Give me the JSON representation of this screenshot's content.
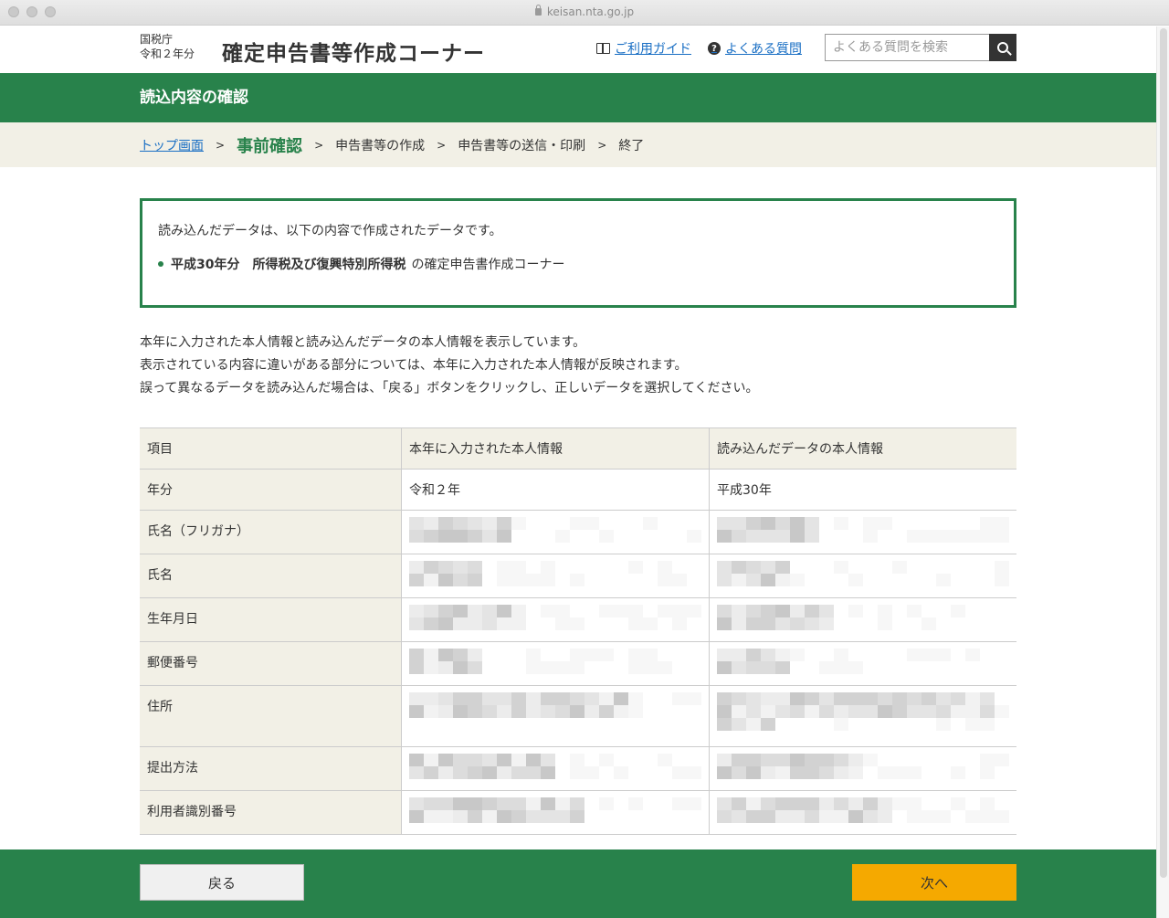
{
  "browser": {
    "url": "keisan.nta.go.jp"
  },
  "header": {
    "agency_line1": "国税庁",
    "agency_line2": "令和２年分",
    "title": "確定申告書等作成コーナー",
    "guide_link": "ご利用ガイド",
    "faq_link": "よくある質問",
    "search_placeholder": "よくある質問を検索"
  },
  "band_title": "読込内容の確認",
  "breadcrumb": {
    "top": "トップ画面",
    "current": "事前確認",
    "step3": "申告書等の作成",
    "step4": "申告書等の送信・印刷",
    "step5": "終了"
  },
  "notice": {
    "intro": "読み込んだデータは、以下の内容で作成されたデータです。",
    "item_bold": "平成30年分　所得税及び復興特別所得税",
    "item_rest": "の確定申告書作成コーナー"
  },
  "description": [
    "本年に入力された本人情報と読み込んだデータの本人情報を表示しています。",
    "表示されている内容に違いがある部分については、本年に入力された本人情報が反映されます。",
    "誤って異なるデータを読み込んだ場合は、「戻る」ボタンをクリックし、正しいデータを選択してください。"
  ],
  "table": {
    "headers": [
      "項目",
      "本年に入力された本人情報",
      "読み込んだデータの本人情報"
    ],
    "rows": [
      {
        "label": "年分",
        "current": "令和２年",
        "loaded": "平成30年"
      },
      {
        "label": "氏名（フリガナ）"
      },
      {
        "label": "氏名"
      },
      {
        "label": "生年月日"
      },
      {
        "label": "郵便番号"
      },
      {
        "label": "住所"
      },
      {
        "label": "提出方法"
      },
      {
        "label": "利用者識別番号"
      }
    ]
  },
  "footer": {
    "back_label": "戻る",
    "next_label": "次へ"
  },
  "colors": {
    "brand_green": "#28824b",
    "next_button": "#f5a900",
    "link": "#1a6fc4",
    "band_bg": "#f2f0e6"
  }
}
